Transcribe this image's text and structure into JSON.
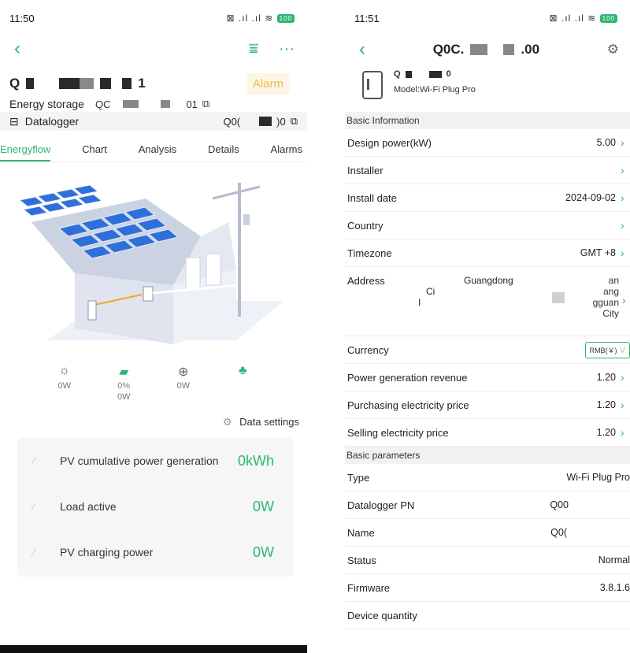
{
  "left": {
    "status": {
      "time": "11:50",
      "icons": "⊠ .ıl .ıl ≋",
      "battery": "100"
    },
    "plant": {
      "name_start": "Q",
      "name_end": "1",
      "alarm_label": "Alarm"
    },
    "energy_storage": {
      "label": "Energy storage",
      "sn_start": "QC",
      "sn_end": "01"
    },
    "datalogger": {
      "label": "Datalogger",
      "sn_start": "Q0(",
      "sn_end": ")0"
    },
    "tabs": [
      "Energyflow",
      "Chart",
      "Analysis",
      "Details",
      "Alarms"
    ],
    "stats": [
      {
        "icon": "sun-icon",
        "line1": "0W",
        "line2": ""
      },
      {
        "icon": "battery-icon",
        "line1": "0%",
        "line2": "0W"
      },
      {
        "icon": "grid-icon",
        "line1": "0W",
        "line2": ""
      },
      {
        "icon": "plant-icon",
        "line1": "",
        "line2": ""
      }
    ],
    "data_settings": "Data settings",
    "card": [
      {
        "label": "PV cumulative power generation",
        "value": "0kWh"
      },
      {
        "label": "Load active",
        "value": "0W"
      },
      {
        "label": "PV charging power",
        "value": "0W"
      }
    ],
    "colors": {
      "accent": "#2bb673",
      "alarm": "#f0b84a"
    }
  },
  "right": {
    "status": {
      "time": "11:51",
      "icons": "⊠ .ıl .ıl ≋",
      "battery": "100"
    },
    "title_start": "Q0C.",
    "title_end": ".00",
    "device": {
      "sn_start": "Q",
      "sn_end": "0",
      "model": "Model:Wi-Fi Plug Pro"
    },
    "basic_info_header": "Basic Information",
    "rows_a": [
      {
        "label": "Design power(kW)",
        "value": "5.00"
      },
      {
        "label": "Installer",
        "value": ""
      },
      {
        "label": "Install date",
        "value": "2024-09-02"
      },
      {
        "label": "Country",
        "value": ""
      },
      {
        "label": "Timezone",
        "value": "GMT +8"
      }
    ],
    "address": {
      "label": "Address",
      "province": "Guangdong",
      "lines": [
        "an",
        "ang",
        "gguan",
        "City"
      ],
      "line2_start": "Ci",
      "line3_start": "I"
    },
    "currency": {
      "label": "Currency",
      "value": "RMB(￥)"
    },
    "rows_b": [
      {
        "label": "Power generation revenue",
        "value": "1.20"
      },
      {
        "label": "Purchasing electricity price",
        "value": "1.20"
      },
      {
        "label": "Selling electricity price",
        "value": "1.20"
      }
    ],
    "basic_params_header": "Basic parameters",
    "rows_c": [
      {
        "label": "Type",
        "value": "Wi-Fi Plug Pro"
      },
      {
        "label": "Datalogger PN",
        "value": "Q00"
      },
      {
        "label": "Name",
        "value": "Q0("
      },
      {
        "label": "Status",
        "value": "Normal"
      },
      {
        "label": "Firmware",
        "value": "3.8.1.6"
      },
      {
        "label": "Device quantity",
        "value": ""
      }
    ]
  }
}
